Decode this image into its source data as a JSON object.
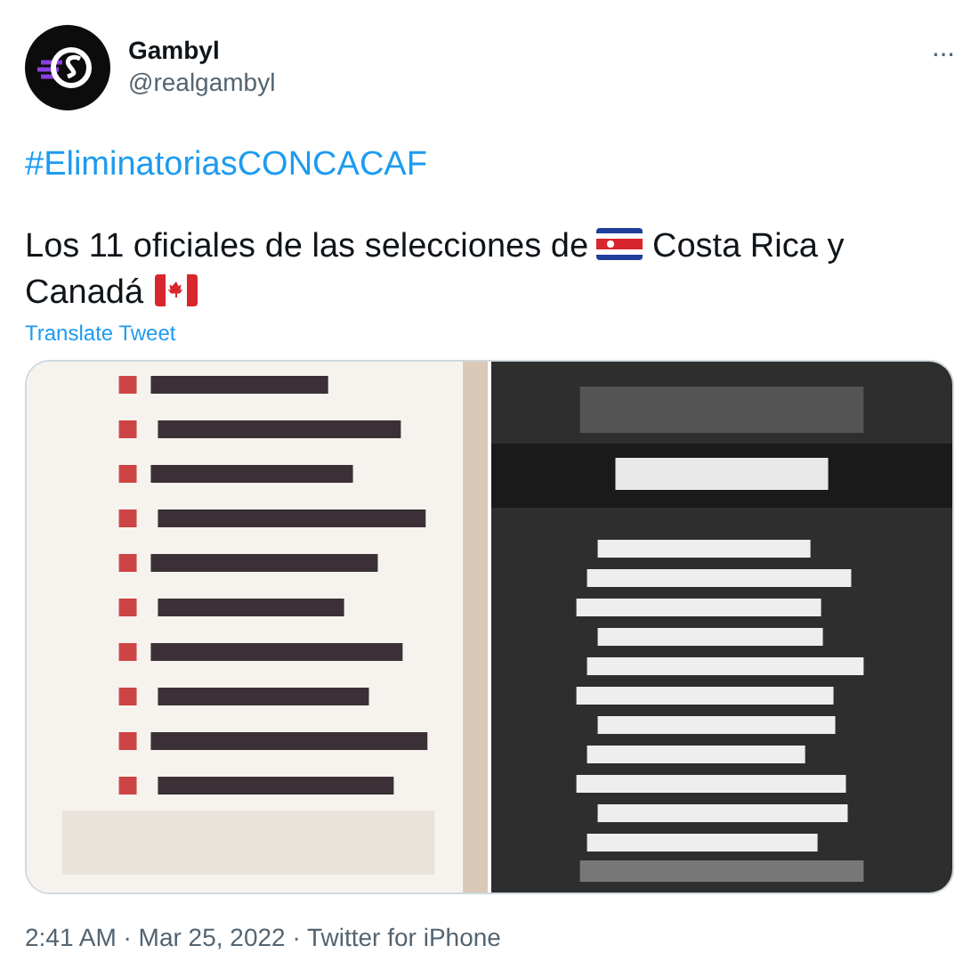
{
  "author": {
    "name": "Gambyl",
    "handle": "@realgambyl"
  },
  "more_button": "···",
  "hashtag": "#EliminatoriasCONCACAF",
  "text": [
    {
      "kind": "text",
      "text": "Los 11 oficiales de las selecciones de"
    },
    {
      "kind": "crflag"
    },
    {
      "kind": "text",
      "text": "Costa Rica y"
    },
    {
      "kind": "break"
    },
    {
      "kind": "text",
      "text": "Canadá"
    },
    {
      "kind": "caflag"
    }
  ],
  "translate_link": "Translate Tweet",
  "footer": "2:41 AM · Mar 25, 2022 · Twitter for iPhone"
}
